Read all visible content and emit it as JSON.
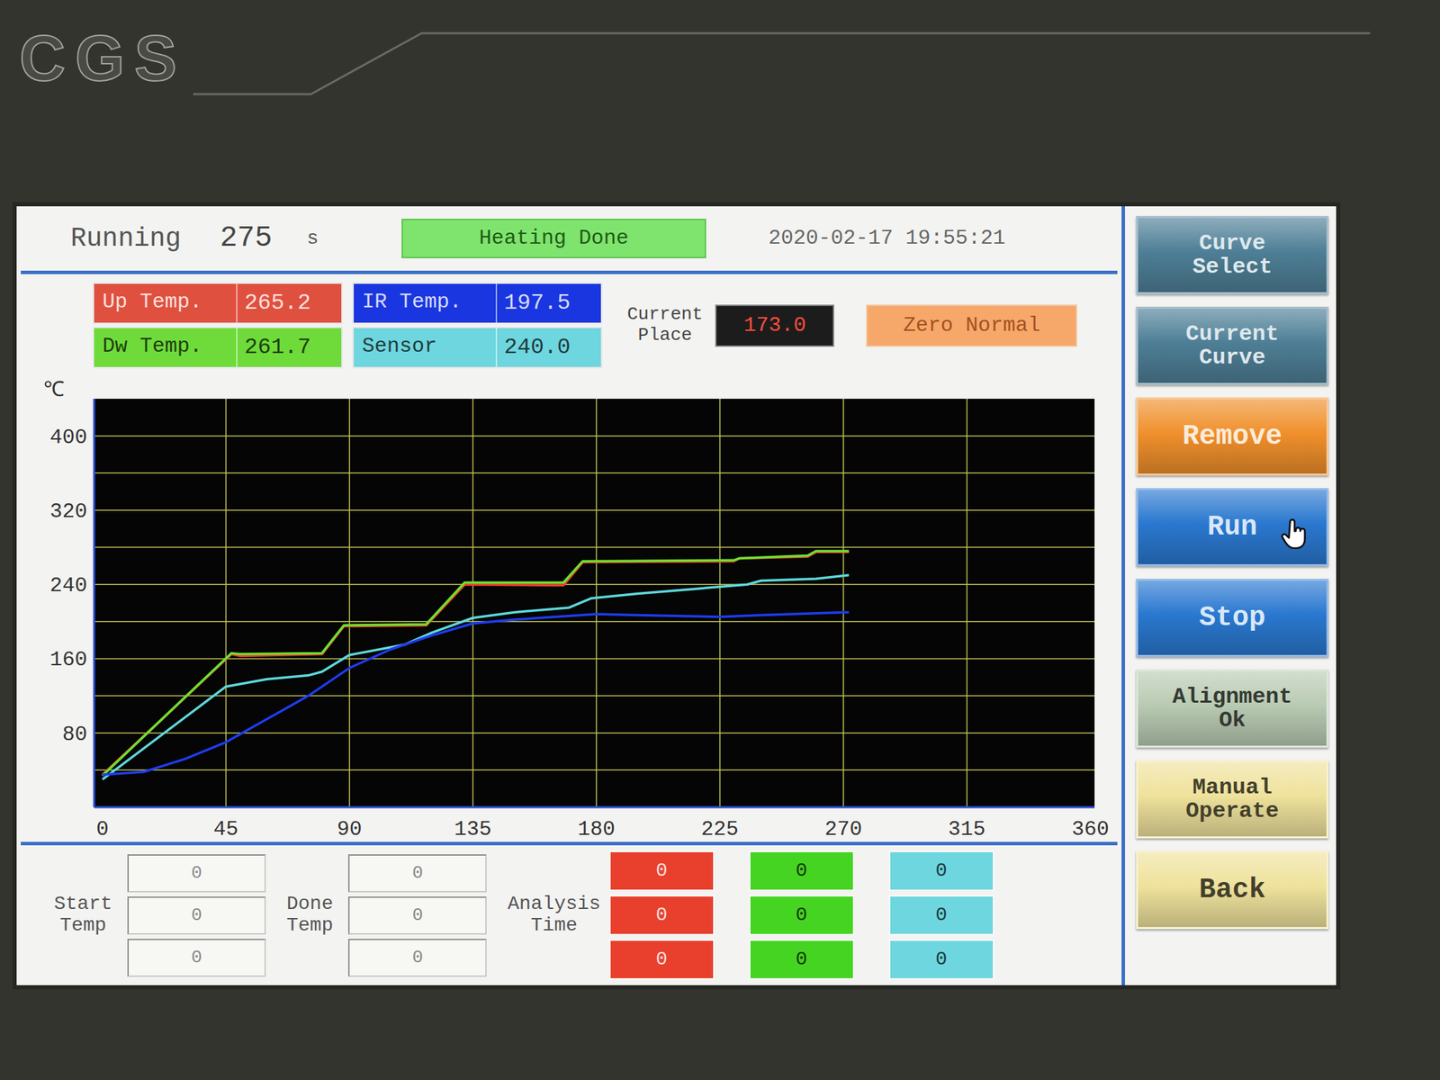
{
  "logo": {
    "text": "CGS"
  },
  "header": {
    "running_label": "Running",
    "running_value": "275",
    "running_unit": "s",
    "status": "Heating Done",
    "datetime": "2020-02-17 19:55:21"
  },
  "readouts": [
    {
      "label": "Up Temp.",
      "value": "265.2",
      "color": "#e0503f"
    },
    {
      "label": "Dw Temp.",
      "value": "261.7",
      "color": "#6edb3a"
    },
    {
      "label": "IR Temp.",
      "value": "197.5",
      "color": "#1a36e0"
    },
    {
      "label": "Sensor",
      "value": "240.0",
      "color": "#6ed6de"
    }
  ],
  "current_place": {
    "label_lines": [
      "Current",
      "Place"
    ],
    "value": "173.0"
  },
  "zero_status": "Zero Normal",
  "chart": {
    "y_unit": "℃",
    "y_ticks": [
      "400",
      "320",
      "240",
      "160",
      "80"
    ],
    "x_ticks": [
      "0",
      "45",
      "90",
      "135",
      "180",
      "225",
      "270",
      "315",
      "360"
    ],
    "series": [
      {
        "color": "#e8402c",
        "t": [
          0,
          47,
          50,
          80,
          88,
          118,
          132,
          168,
          175,
          230,
          232,
          257,
          260,
          272
        ],
        "values": [
          35,
          165,
          163,
          165,
          195,
          196,
          240,
          239,
          264,
          265,
          268,
          270,
          275,
          275
        ]
      },
      {
        "color": "#6ee030",
        "t": [
          0,
          47,
          50,
          80,
          88,
          118,
          132,
          168,
          175,
          230,
          232,
          257,
          260,
          272
        ],
        "values": [
          34,
          166,
          165,
          166,
          196,
          197,
          242,
          242,
          265,
          266,
          268,
          271,
          276,
          276
        ]
      },
      {
        "color": "#5ed8dc",
        "t": [
          0,
          45,
          60,
          75,
          80,
          90,
          110,
          120,
          135,
          150,
          170,
          178,
          195,
          215,
          235,
          240,
          260,
          272
        ],
        "values": [
          30,
          130,
          138,
          142,
          146,
          164,
          175,
          188,
          204,
          210,
          215,
          225,
          230,
          235,
          240,
          244,
          246,
          250
        ]
      },
      {
        "color": "#1e3cf0",
        "t": [
          0,
          15,
          30,
          45,
          60,
          75,
          90,
          105,
          120,
          135,
          150,
          165,
          180,
          195,
          225,
          240,
          270,
          272
        ],
        "values": [
          35,
          38,
          52,
          70,
          95,
          120,
          150,
          170,
          185,
          198,
          202,
          205,
          208,
          207,
          205,
          207,
          210,
          210
        ]
      }
    ]
  },
  "bottom": {
    "start_temp": {
      "label_lines": [
        "Start",
        "Temp"
      ],
      "values": [
        "0",
        "0",
        "0"
      ]
    },
    "done_temp": {
      "label_lines": [
        "Done",
        "Temp"
      ],
      "values": [
        "0",
        "0",
        "0"
      ]
    },
    "analysis_time": {
      "label_lines": [
        "Analysis",
        "Time"
      ],
      "columns": [
        {
          "color": "#e8402c",
          "values": [
            "0",
            "0",
            "0"
          ]
        },
        {
          "color": "#46d422",
          "values": [
            "0",
            "0",
            "0"
          ]
        },
        {
          "color": "#6ed6de",
          "values": [
            "0",
            "0",
            "0"
          ]
        }
      ]
    }
  },
  "side_buttons": [
    {
      "lines": [
        "Curve",
        "Select"
      ],
      "color": "#4e7f96",
      "cursor": false
    },
    {
      "lines": [
        "Current",
        "Curve"
      ],
      "color": "#4e7f96",
      "cursor": false
    },
    {
      "lines": [
        "Remove"
      ],
      "color": "#f0902c",
      "cursor": false
    },
    {
      "lines": [
        "Run"
      ],
      "color": "#2a78d0",
      "cursor": true
    },
    {
      "lines": [
        "Stop"
      ],
      "color": "#2a78d0",
      "cursor": false
    },
    {
      "lines": [
        "Alignment",
        "Ok"
      ],
      "color": "#b9cbb3",
      "cursor": false
    },
    {
      "lines": [
        "Manual",
        "Operate"
      ],
      "color": "#efe29c",
      "cursor": false
    },
    {
      "lines": [
        "Back"
      ],
      "color": "#efe29c",
      "cursor": false
    }
  ]
}
